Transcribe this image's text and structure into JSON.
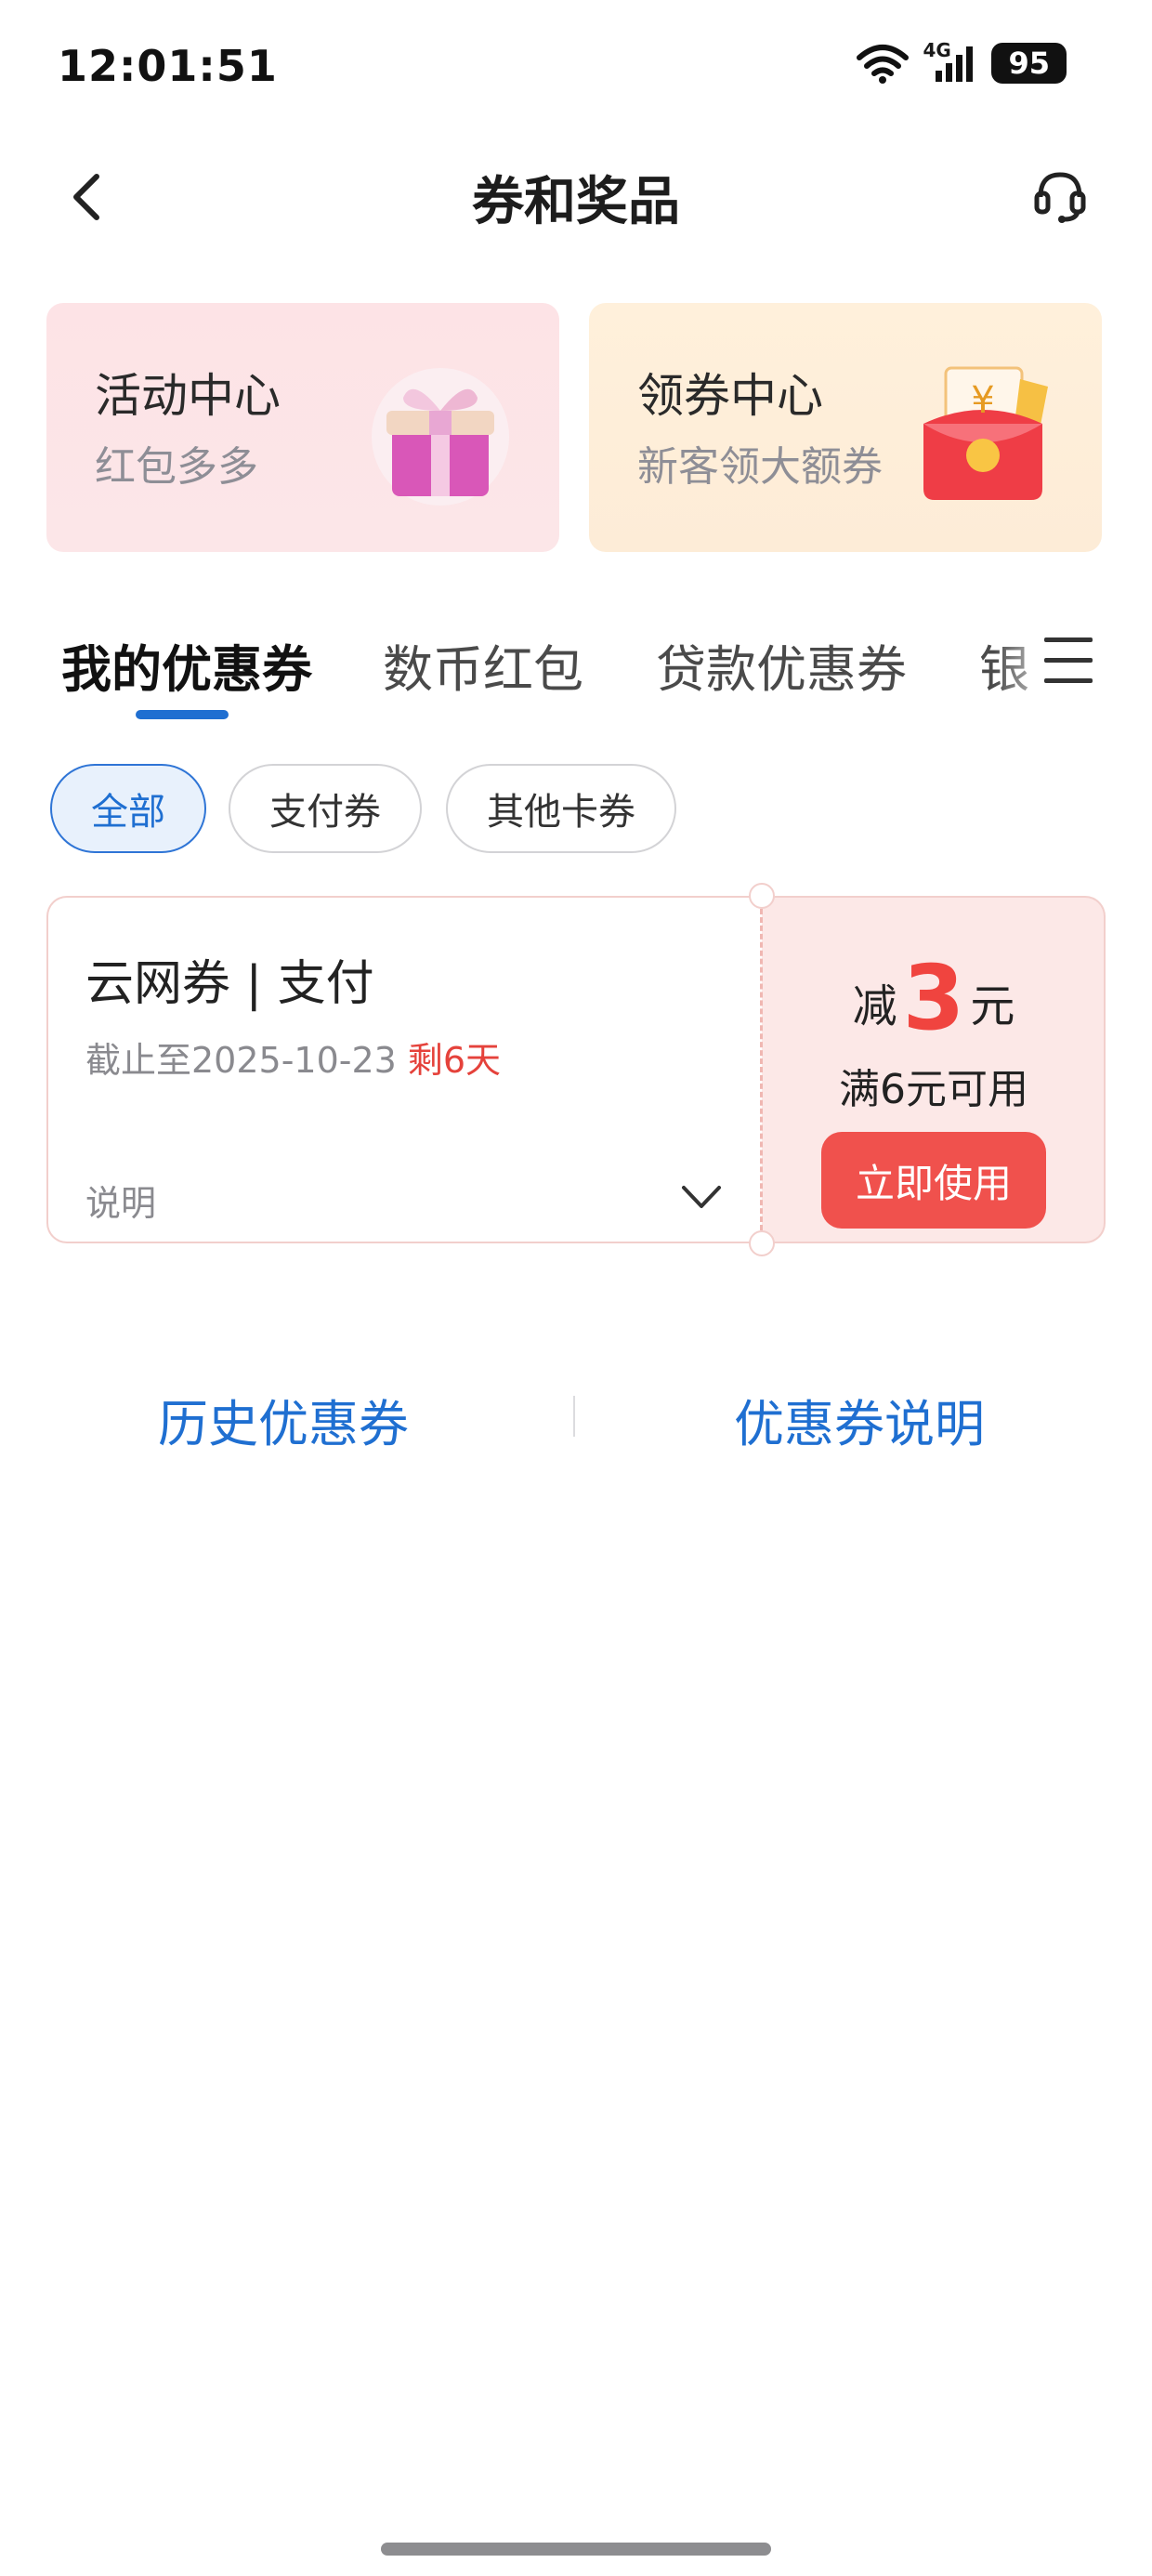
{
  "status_bar": {
    "time": "12:01:51",
    "network": "4G",
    "battery": "95",
    "icons": [
      "wifi-icon",
      "cellular-signal-icon",
      "battery-icon"
    ]
  },
  "header": {
    "title": "券和奖品",
    "back_icon": "chevron-left-icon",
    "service_icon": "headset-icon"
  },
  "promo_cards": [
    {
      "title": "活动中心",
      "subtitle": "红包多多",
      "icon": "gift-box-icon"
    },
    {
      "title": "领券中心",
      "subtitle": "新客领大额券",
      "icon": "red-envelope-icon"
    }
  ],
  "tabs": [
    {
      "label": "我的优惠券",
      "active": true
    },
    {
      "label": "数币红包",
      "active": false
    },
    {
      "label": "贷款优惠券",
      "active": false
    },
    {
      "label": "银",
      "active": false
    }
  ],
  "filters": [
    {
      "label": "全部",
      "active": true
    },
    {
      "label": "支付券",
      "active": false
    },
    {
      "label": "其他卡券",
      "active": false
    }
  ],
  "coupon": {
    "name": "云网券 | 支付",
    "deadline": "截止至2025-10-23",
    "remaining": "剩6天",
    "note": "说明",
    "prefix": "减",
    "amount": "3",
    "unit": "元",
    "condition": "满6元可用",
    "use_button": "立即使用"
  },
  "footer_links": {
    "history": "历史优惠券",
    "explanation": "优惠券说明"
  },
  "colors": {
    "accent_blue": "#1f6fd1",
    "coupon_red": "#f0443f",
    "button_red": "#f0514d",
    "promo_pink": "#fde3e6",
    "promo_orange": "#fff0db"
  }
}
